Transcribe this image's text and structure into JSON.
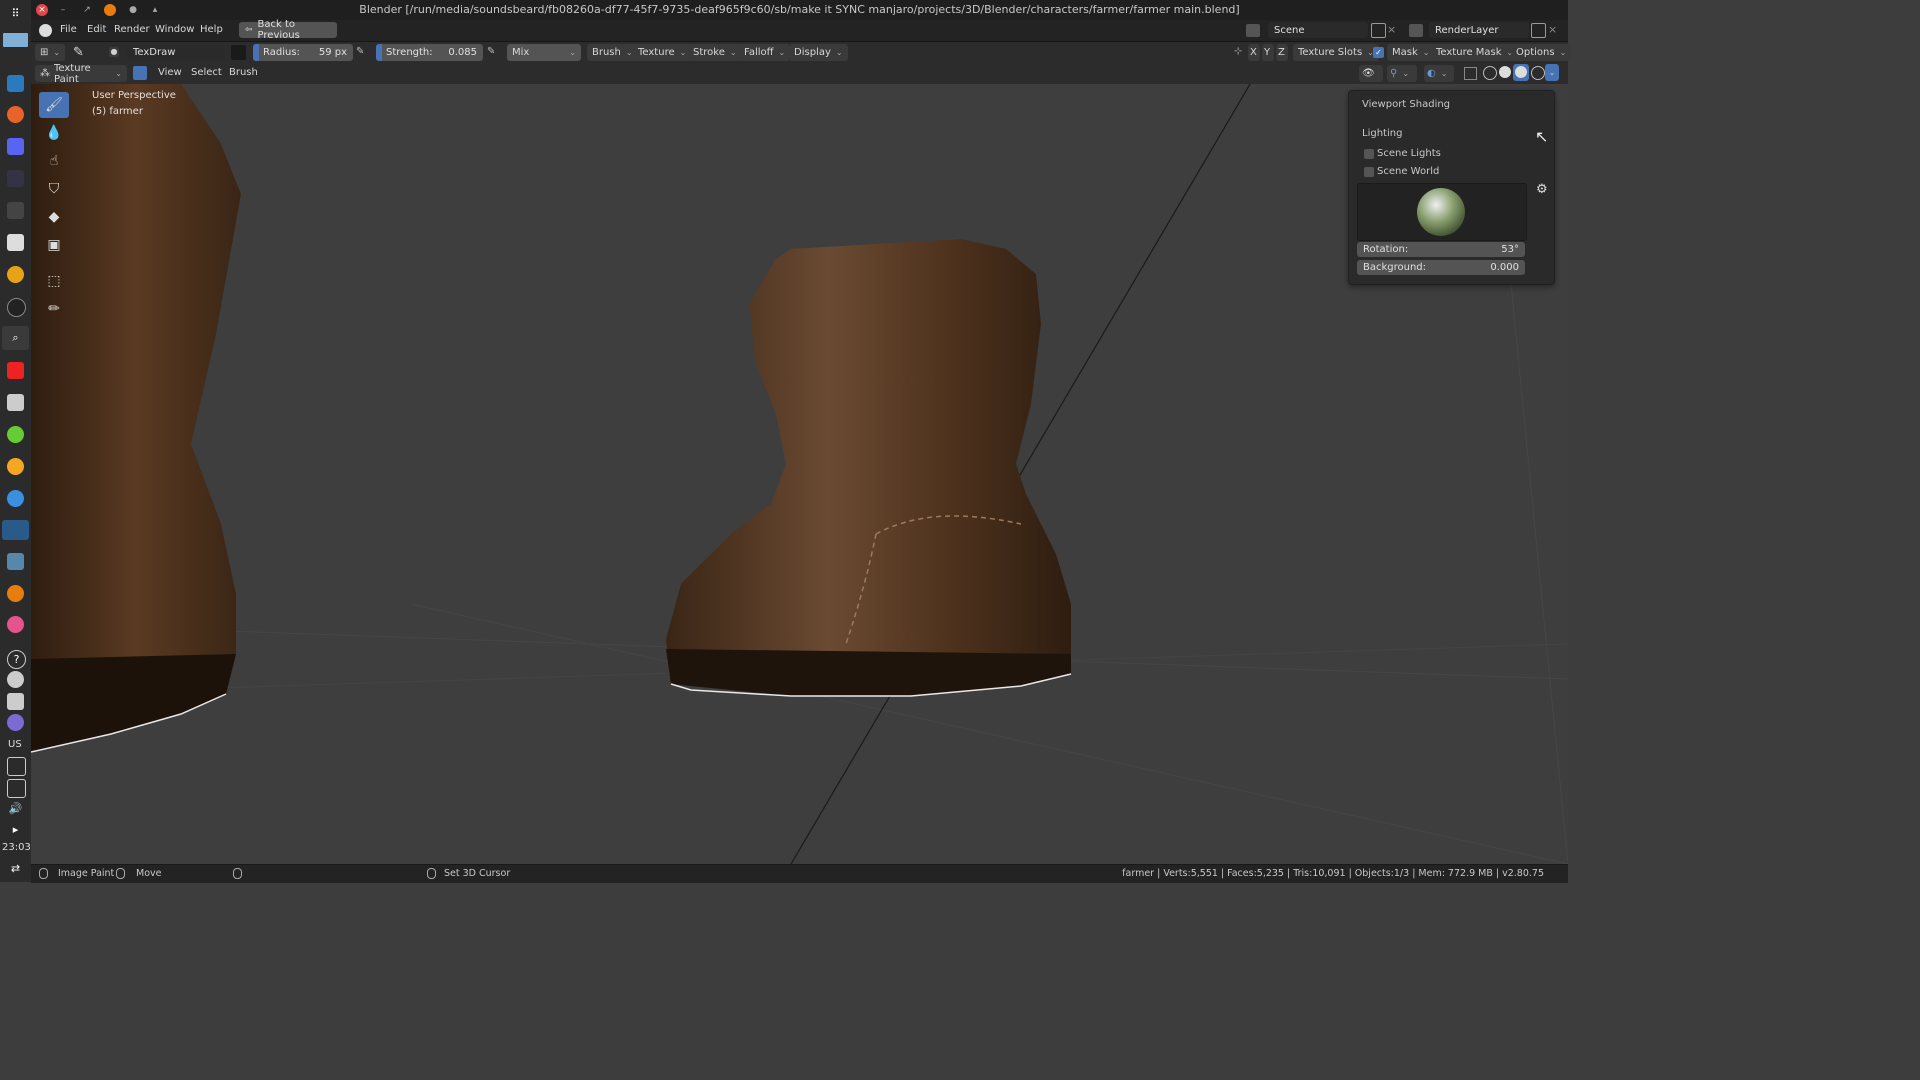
{
  "window": {
    "title": "Blender [/run/media/soundsbeard/fb08260a-df77-45f7-9735-deaf965f9c60/sb/make it SYNC manjaro/projects/3D/Blender/characters/farmer/farmer main.blend]"
  },
  "menu": {
    "items": [
      "File",
      "Edit",
      "Render",
      "Window",
      "Help"
    ],
    "back_button": "Back to Previous",
    "scene_label": "Scene",
    "renderlayer_label": "RenderLayer"
  },
  "toolbar": {
    "brush_name": "TexDraw",
    "radius_label": "Radius:",
    "radius_value": "59 px",
    "strength_label": "Strength:",
    "strength_value": "0.085",
    "blend_mode": "Mix",
    "brush": "Brush",
    "texture": "Texture",
    "stroke": "Stroke",
    "falloff": "Falloff",
    "display": "Display",
    "axes": [
      "X",
      "Y",
      "Z"
    ],
    "texture_slots": "Texture Slots",
    "mask": "Mask",
    "texture_mask": "Texture Mask",
    "options": "Options"
  },
  "header": {
    "mode": "Texture Paint",
    "view": "View",
    "select": "Select",
    "brush": "Brush"
  },
  "viewport": {
    "perspective": "User Perspective",
    "object": "(5) farmer"
  },
  "shading": {
    "title": "Viewport Shading",
    "lighting": "Lighting",
    "scene_lights": "Scene Lights",
    "scene_world": "Scene World",
    "rotation_label": "Rotation:",
    "rotation_value": "53°",
    "background_label": "Background:",
    "background_value": "0.000"
  },
  "status": {
    "image_paint": "Image Paint",
    "move": "Move",
    "set_cursor": "Set 3D Cursor",
    "stats": "farmer | Verts:5,551 | Faces:5,235 | Tris:10,091 | Objects:1/3 | Mem: 772.9 MB | v2.80.75"
  },
  "dock": {
    "clock": "23:03",
    "keyboard": "US"
  },
  "colors": {
    "accent": "#4772b3",
    "boot": "#5a3a22"
  }
}
